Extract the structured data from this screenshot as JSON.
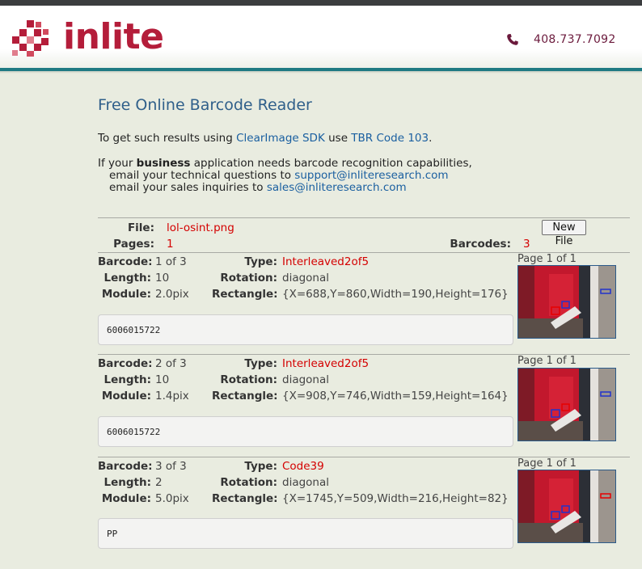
{
  "header": {
    "logo_text": "inlite",
    "phone": "408.737.7092",
    "brand_color": "#b41d3a",
    "accent_line_color": "#1f7a83"
  },
  "intro": {
    "title": "Free Online Barcode Reader",
    "line1_pre": "To get such results using ",
    "line1_link1": "ClearImage SDK",
    "line1_mid": " use ",
    "line1_link2": "TBR Code 103",
    "line1_post": ".",
    "line2_pre": "If your ",
    "line2_bold": "business",
    "line2_post": " application needs barcode recognition capabilities,",
    "line3_pre": "email your technical questions to ",
    "line3_link": "support@inliteresearch.com",
    "line4_pre": "email your sales inquiries to ",
    "line4_link": "sales@inliteresearch.com"
  },
  "file_info": {
    "file_label": "File:",
    "file_name": "lol-osint.png",
    "pages_label": "Pages:",
    "pages_value": "1",
    "barcodes_label": "Barcodes:",
    "barcodes_value": "3",
    "new_file_button": "New File"
  },
  "labels": {
    "barcode": "Barcode:",
    "length": "Length:",
    "module": "Module:",
    "type": "Type:",
    "rotation": "Rotation:",
    "rectangle": "Rectangle:"
  },
  "results": [
    {
      "barcode": "1 of 3",
      "length": "10",
      "module": "2.0pix",
      "type": "Interleaved2of5",
      "rotation": "diagonal",
      "rectangle": "{X=688,Y=860,Width=190,Height=176}",
      "text": "6006015722",
      "page_caption": "Page 1 of 1"
    },
    {
      "barcode": "2 of 3",
      "length": "10",
      "module": "1.4pix",
      "type": "Interleaved2of5",
      "rotation": "diagonal",
      "rectangle": "{X=908,Y=746,Width=159,Height=164}",
      "text": "6006015722",
      "page_caption": "Page 1 of 1"
    },
    {
      "barcode": "3 of 3",
      "length": "2",
      "module": "5.0pix",
      "type": "Code39",
      "rotation": "diagonal",
      "rectangle": "{X=1745,Y=509,Width=216,Height=82}",
      "text": "PP",
      "page_caption": "Page 1 of 1"
    }
  ]
}
